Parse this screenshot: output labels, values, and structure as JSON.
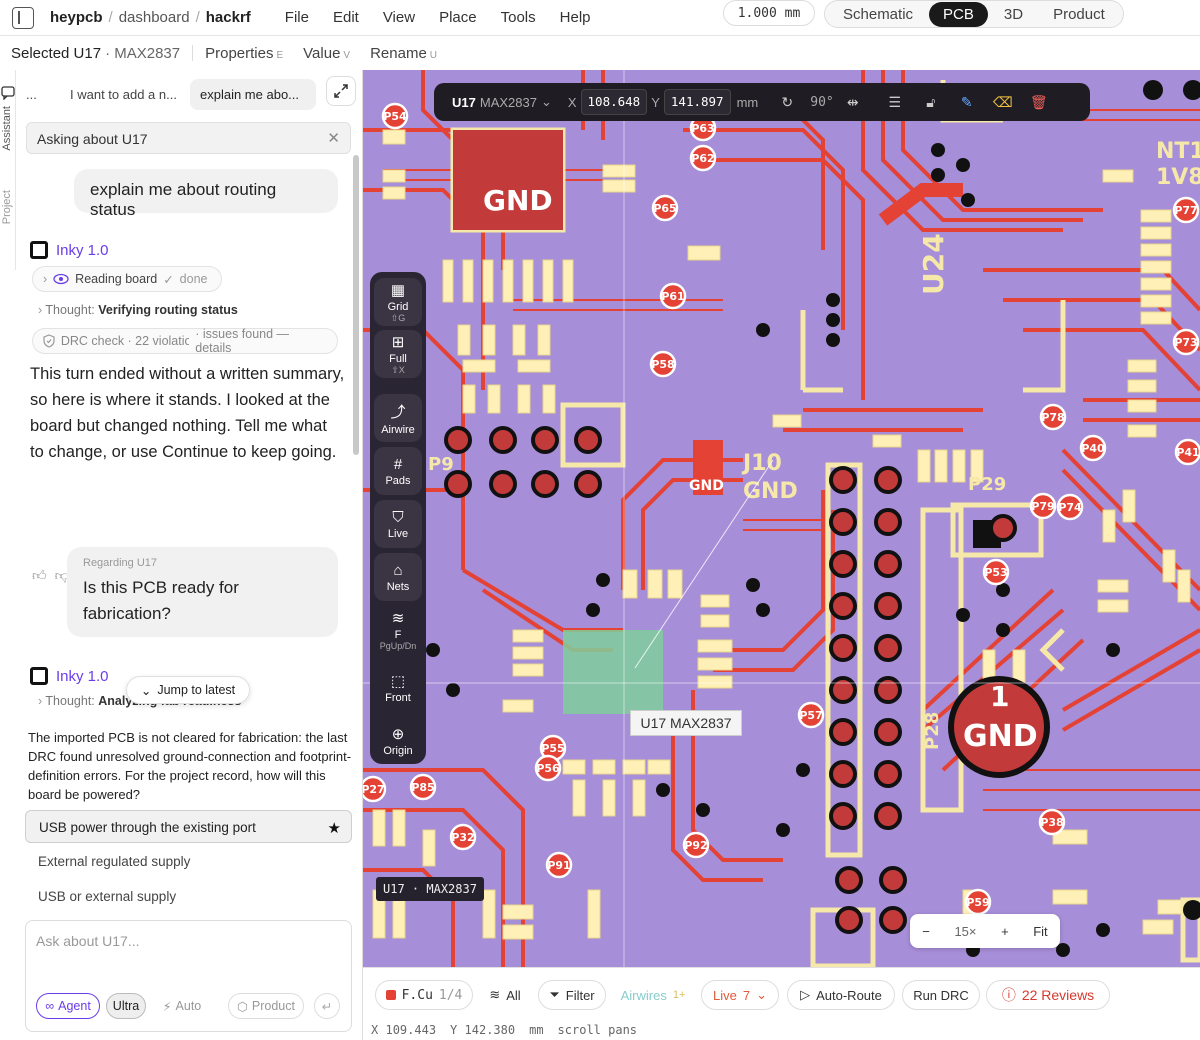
{
  "header": {
    "breadcrumb": [
      "heypcb",
      "dashboard",
      "hackrf"
    ],
    "menus": [
      "File",
      "Edit",
      "View",
      "Place",
      "Tools",
      "Help"
    ],
    "units": "1.000 mm",
    "view_tabs": [
      "Schematic",
      "PCB",
      "3D",
      "Product"
    ],
    "active_view": "PCB"
  },
  "selection": {
    "label": "Selected U17",
    "part": "· MAX2837",
    "actions": [
      {
        "label": "Properties",
        "key": "E"
      },
      {
        "label": "Value",
        "key": "V"
      },
      {
        "label": "Rename",
        "key": "U"
      }
    ]
  },
  "siderail": [
    "Assistant",
    "Project"
  ],
  "chat": {
    "tabs": [
      "...",
      "I want to add a n...",
      "explain me abo..."
    ],
    "context": "Asking about U17",
    "user1": "explain me about routing status",
    "inky1": "Inky 1.0",
    "chip_reading": "Reading board",
    "chip_done": "done",
    "thought1_prefix": "Thought:",
    "thought1": "Verifying routing status",
    "drc_chip": "DRC check · 22 violatio...",
    "drc_chip_right": "· issues found — details",
    "para1": "This turn ended without a written summary, so here is where it stands. I looked at the board but changed nothing. Tell me what to change, or use Continue to keep going.",
    "user2_regarding": "Regarding U17",
    "user2": "Is this PCB ready for fabrication?",
    "inky2": "Inky 1.0",
    "thought2_prefix": "Thought:",
    "thought2": "Analyzing fab readiness",
    "jump": "Jump to latest",
    "question": "The imported PCB is not cleared for fabrication: the last DRC found unresolved ground-connection and footprint-definition errors. For the project record, how will this board be powered?",
    "options": [
      "USB power through the existing port",
      "External regulated supply",
      "USB or external supply"
    ],
    "input_placeholder": "Ask about U17...",
    "modes": [
      "Agent",
      "Ultra",
      "Auto",
      "Product"
    ]
  },
  "toolbar": {
    "ref": "U17",
    "part": "MAX2837",
    "x_label": "X",
    "x": "108.648",
    "y_label": "Y",
    "y": "141.897",
    "unit": "mm",
    "rotation": "90°"
  },
  "left_tools": [
    {
      "label": "Grid",
      "key": "⇧G"
    },
    {
      "label": "Full",
      "key": "⇧X"
    },
    {
      "label": "Airwire",
      "key": ""
    },
    {
      "label": "Pads",
      "key": ""
    },
    {
      "label": "Live",
      "key": ""
    },
    {
      "label": "Nets",
      "key": ""
    },
    {
      "label": "F",
      "key": "PgUp/Dn"
    },
    {
      "label": "Front",
      "key": ""
    },
    {
      "label": "Origin",
      "key": ""
    }
  ],
  "board": {
    "tooltip": "U17 MAX2837",
    "tag": "U17 · MAX2837",
    "labels": [
      "GND",
      "GND",
      "J10",
      "GND",
      "U24",
      "P28",
      "P29",
      "NT1",
      "1V8",
      "P9",
      "P79",
      "P40",
      "P41",
      "P53",
      "P55",
      "P56",
      "P57",
      "P58",
      "P59",
      "P61",
      "P62",
      "P63",
      "P65",
      "P73",
      "P74",
      "P77",
      "P78",
      "P85",
      "P91",
      "P92",
      "P27",
      "P32",
      "P38",
      "P54",
      "1"
    ]
  },
  "zoom": {
    "minus": "−",
    "level": "15×",
    "plus": "+",
    "fit": "Fit"
  },
  "bottom": {
    "layer": "F.Cu",
    "layer_count": "1/4",
    "all": "All",
    "filter": "Filter",
    "airwires": "Airwires",
    "airwires_count": "1+",
    "live": "Live",
    "live_count": "7",
    "autoroute": "Auto-Route",
    "run_drc": "Run DRC",
    "reviews": "22 Reviews",
    "colors": {
      "layer": "#e34234",
      "reviews": "#d63a2f",
      "airwires": "#8cc",
      "live": "#e25a3a"
    }
  },
  "status": {
    "x_label": "X",
    "x": "109.443",
    "y_label": "Y",
    "y": "142.380",
    "unit": "mm",
    "hint": "scroll pans"
  }
}
